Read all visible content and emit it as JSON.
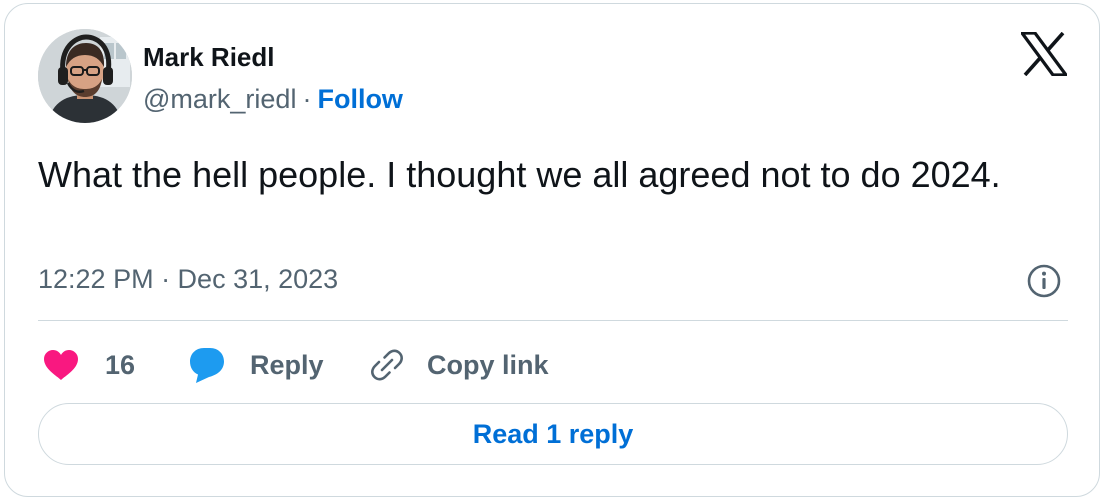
{
  "author": {
    "name": "Mark Riedl",
    "handle": "@mark_riedl",
    "separator": "·",
    "follow_label": "Follow",
    "avatar_icon": "profile-photo-with-headphones-and-glasses"
  },
  "brand": {
    "logo_icon": "x-logo"
  },
  "tweet": {
    "text": "What the hell people. I thought we all agreed not to do 2024.",
    "timestamp": "12:22 PM · Dec 31, 2023"
  },
  "actions": {
    "like_count": "16",
    "reply_label": "Reply",
    "copy_link_label": "Copy link"
  },
  "read_replies_label": "Read 1 reply",
  "colors": {
    "like": "#f91880",
    "reply": "#1d9bf0",
    "link_blue": "#006fd6",
    "muted_text": "#536471",
    "border": "#cfd9de"
  }
}
